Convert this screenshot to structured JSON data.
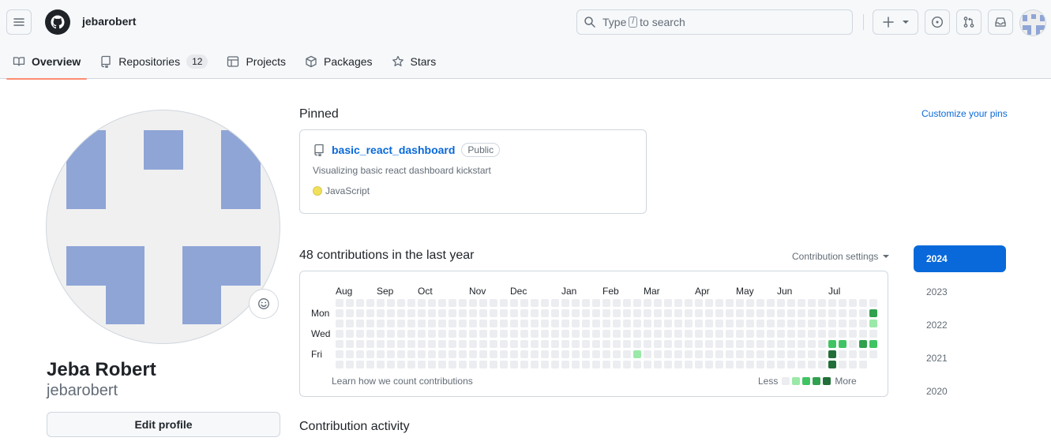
{
  "header": {
    "username": "jebarobert",
    "search": {
      "prefix": "Type",
      "key": "/",
      "suffix": "to search"
    }
  },
  "icons": {
    "menu": "hamburger-icon",
    "logo": "github-logo",
    "search": "search-icon",
    "plus": "plus-icon",
    "issues": "issue-circle-icon",
    "pulls": "pull-request-icon",
    "inbox": "inbox-icon"
  },
  "tabs": [
    {
      "label": "Overview",
      "icon": "book-icon",
      "active": true
    },
    {
      "label": "Repositories",
      "icon": "repo-icon",
      "count": "12"
    },
    {
      "label": "Projects",
      "icon": "table-icon"
    },
    {
      "label": "Packages",
      "icon": "package-icon"
    },
    {
      "label": "Stars",
      "icon": "star-icon"
    }
  ],
  "profile": {
    "name": "Jeba Robert",
    "login": "jebarobert",
    "edit_label": "Edit profile",
    "avatar_color": "#8fa5d6"
  },
  "pinned": {
    "title": "Pinned",
    "customize_label": "Customize your pins",
    "items": [
      {
        "name": "basic_react_dashboard",
        "visibility": "Public",
        "description": "Visualizing basic react dashboard kickstart",
        "language": "JavaScript",
        "language_color": "#f1e05a"
      }
    ]
  },
  "contributions": {
    "title": "48 contributions in the last year",
    "settings_label": "Contribution settings",
    "months": [
      "Aug",
      "Sep",
      "Oct",
      "Nov",
      "Dec",
      "Jan",
      "Feb",
      "Mar",
      "Apr",
      "May",
      "Jun",
      "Jul"
    ],
    "days": [
      "Mon",
      "Wed",
      "Fri"
    ],
    "learn_label": "Learn how we count contributions",
    "legend_less": "Less",
    "legend_more": "More",
    "levels": [
      "#ebedf0",
      "#9be9a8",
      "#40c463",
      "#30a14e",
      "#216e39"
    ],
    "active_cells": [
      {
        "week": 29,
        "day": 5,
        "level": 1
      },
      {
        "week": 48,
        "day": 4,
        "level": 2
      },
      {
        "week": 48,
        "day": 5,
        "level": 4
      },
      {
        "week": 48,
        "day": 6,
        "level": 4
      },
      {
        "week": 49,
        "day": 4,
        "level": 2
      },
      {
        "week": 51,
        "day": 4,
        "level": 3
      },
      {
        "week": 52,
        "day": 1,
        "level": 3
      },
      {
        "week": 52,
        "day": 2,
        "level": 1
      },
      {
        "week": 52,
        "day": 4,
        "level": 2
      }
    ]
  },
  "years": [
    "2024",
    "2023",
    "2022",
    "2021",
    "2020"
  ],
  "activity_title": "Contribution activity"
}
